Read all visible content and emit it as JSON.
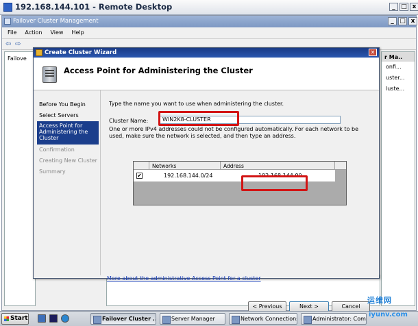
{
  "remote_desktop": {
    "title": "192.168.144.101 - Remote Desktop"
  },
  "fcm": {
    "title": "Failover Cluster Management",
    "menu": [
      "File",
      "Action",
      "View",
      "Help"
    ],
    "tree_root": "Failove",
    "right_header": "r Ma..",
    "right_items": [
      "onfi...",
      "uster...",
      "luste..."
    ]
  },
  "wizard": {
    "title": "Create Cluster Wizard",
    "heading": "Access Point for Administering the Cluster",
    "nav": [
      "Before You Begin",
      "Select Servers",
      "Access Point for Administering the Cluster",
      "Confirmation",
      "Creating New Cluster",
      "Summary"
    ],
    "instruction": "Type the name you want to use when administering the cluster.",
    "cluster_name_label": "Cluster Name:",
    "cluster_name_value": "WIN2K8-CLUSTER",
    "ipv4_note": "One or more IPv4 addresses could not be configured automatically.  For each network to be used, make sure the network is selected, and then type an address.",
    "networks_table": {
      "headers": [
        "Networks",
        "Address"
      ],
      "rows": [
        {
          "checked": "✔",
          "network": "192.168.144.0/24",
          "address": "192.168.144.90"
        }
      ]
    },
    "link": "More about the administrative Access Point for a cluster",
    "buttons": {
      "previous": "< Previous",
      "next": "Next >",
      "cancel": "Cancel"
    }
  },
  "taskbar": {
    "start": "Start",
    "items": [
      "Failover Cluster ...",
      "Server Manager",
      "Network Connections",
      "Administrator: Com..."
    ]
  },
  "watermark": {
    "logo": "运维网",
    "url": "iyunv.com"
  }
}
